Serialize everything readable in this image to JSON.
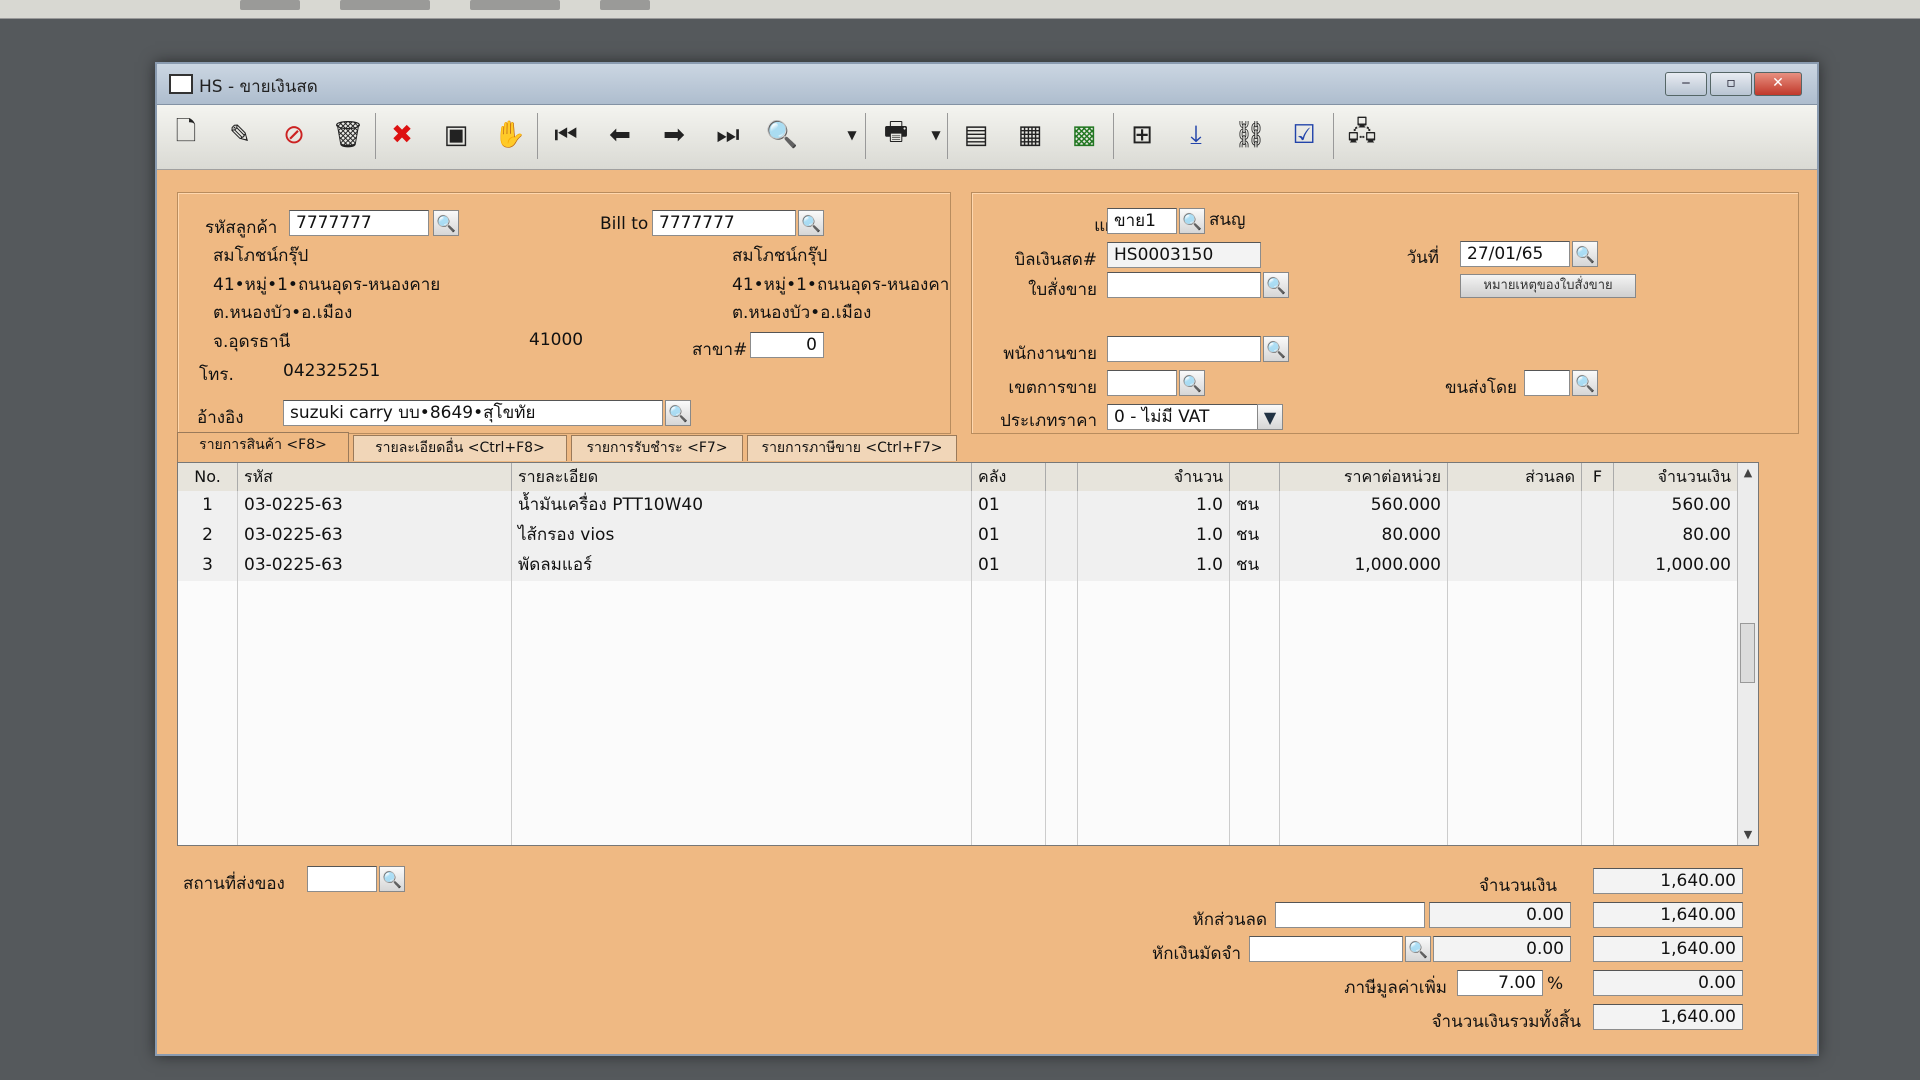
{
  "window": {
    "title": "HS - ขายเงินสด",
    "controls": {
      "minimize": "‒",
      "maximize": "▫",
      "close": "✕"
    }
  },
  "toolbar": {
    "icons": [
      "new-document-icon",
      "edit-icon",
      "void-icon",
      "trash-icon",
      "cancel-icon",
      "save-icon",
      "approve-icon",
      "first-record-icon",
      "previous-record-icon",
      "next-record-icon",
      "last-record-icon",
      "find-icon",
      "print-icon",
      "report-icon",
      "report-form-icon",
      "calculator-icon",
      "recalc-icon",
      "ok-down-icon",
      "link-icon",
      "ok-icon",
      "network-icon"
    ]
  },
  "customer": {
    "code_label": "รหัสลูกค้า",
    "code": "7777777",
    "name": "สมโภชน์กรุ๊ป",
    "address1": "41•หมู่•1•ถนนอุดร-หนองคาย",
    "address2": "ต.หนองบัว•อ.เมือง",
    "province": "จ.อุดรธานี",
    "postcode": "41000",
    "phone_label": "โทร.",
    "phone": "042325251",
    "ref_label": "อ้างอิง",
    "ref": "suzuki carry บบ•8649•สุโขทัย"
  },
  "bill_to": {
    "label": "Bill to",
    "code": "7777777",
    "name": "สมโภชน์กรุ๊ป",
    "address1": "41•หมู่•1•ถนนอุดร-หนองคา",
    "address2": "ต.หนองบัว•อ.เมือง",
    "branch_label": "สาขา#",
    "branch": "0"
  },
  "document": {
    "dept_label": "แผนก",
    "dept": "ขาย1",
    "dept_name": "สนญ",
    "bill_label": "บิลเงินสด#",
    "bill_no": "HS0003150",
    "date_label": "วันที่",
    "date": "27/01/65",
    "order_label": "ใบสั่งขาย",
    "order": "",
    "order_note_button": "หมายเหตุของใบสั่งขาย",
    "salesperson_label": "พนักงานขาย",
    "salesperson": "",
    "area_label": "เขตการขาย",
    "area": "",
    "ship_by_label": "ขนส่งโดย",
    "ship_by": "",
    "price_type_label": "ประเภทราคา",
    "price_type": "0 - ไม่มี VAT"
  },
  "tabs": [
    {
      "label": "รายการสินค้า <F8>",
      "active": true
    },
    {
      "label": "รายละเอียดอื่น <Ctrl+F8>",
      "active": false
    },
    {
      "label": "รายการรับชำระ <F7>",
      "active": false
    },
    {
      "label": "รายการภาษีขาย <Ctrl+F7>",
      "active": false
    }
  ],
  "grid": {
    "headers": {
      "no": "No.",
      "code": "รหัส",
      "desc": "รายละเอียด",
      "wh": "คลัง",
      "qty": "จำนวน",
      "price": "ราคาต่อหน่วย",
      "discount": "ส่วนลด",
      "f": "F",
      "amount": "จำนวนเงิน"
    },
    "rows": [
      {
        "no": "1",
        "code": "03-0225-63",
        "desc": "น้ำมันเครื่อง PTT10W40",
        "wh": "01",
        "qty": "1.0",
        "unit": "ชน",
        "price": "560.000",
        "discount": "",
        "f": "",
        "amount": "560.00"
      },
      {
        "no": "2",
        "code": "03-0225-63",
        "desc": "ไส้กรอง vios",
        "wh": "01",
        "qty": "1.0",
        "unit": "ชน",
        "price": "80.000",
        "discount": "",
        "f": "",
        "amount": "80.00"
      },
      {
        "no": "3",
        "code": "03-0225-63",
        "desc": "พัดลมแอร์",
        "wh": "01",
        "qty": "1.0",
        "unit": "ชน",
        "price": "1,000.000",
        "discount": "",
        "f": "",
        "amount": "1,000.00"
      }
    ]
  },
  "footer": {
    "ship_place_label": "สถานที่ส่งของ",
    "ship_place": "",
    "amount_label": "จำนวนเงิน",
    "amount": "1,640.00",
    "discount_label": "หักส่วนลด",
    "discount_text": "",
    "discount_value": "0.00",
    "after_discount": "1,640.00",
    "deposit_label": "หักเงินมัดจำ",
    "deposit_text": "",
    "deposit_value": "0.00",
    "after_deposit": "1,640.00",
    "vat_label": "ภาษีมูลค่าเพิ่ม",
    "vat_rate": "7.00",
    "vat_pct": "%",
    "vat_amount": "0.00",
    "total_label": "จำนวนเงินรวมทั้งสิ้น",
    "total": "1,640.00"
  },
  "colors": {
    "form_bg": "#efb983",
    "titlebar": "#b9c7d6"
  }
}
